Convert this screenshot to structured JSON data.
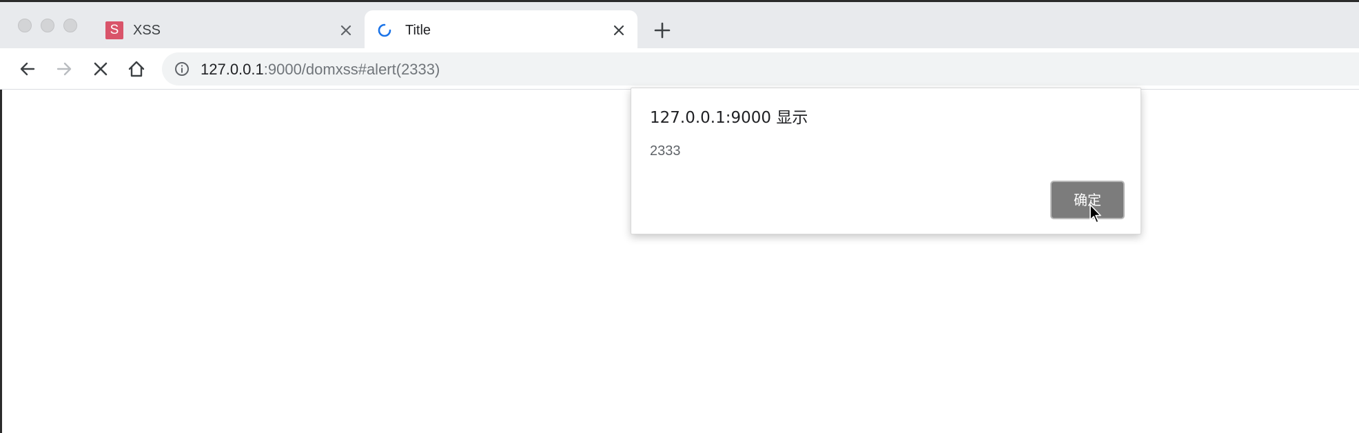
{
  "tabs": [
    {
      "favicon_letter": "S",
      "title": "XSS",
      "favicon_color": "#d9546a",
      "active": false
    },
    {
      "title": "Title",
      "active": true,
      "loading": true,
      "spinner_color": "#1a73e8"
    }
  ],
  "toolbar": {
    "back_icon": "arrow-left-icon",
    "forward_icon": "arrow-right-icon",
    "stop_icon": "close-icon",
    "home_icon": "home-icon"
  },
  "omnibox": {
    "info_icon": "info-icon",
    "url_host": "127.0.0.1",
    "url_rest": ":9000/domxss#alert(2333)"
  },
  "dialog": {
    "title": "127.0.0.1:9000 显示",
    "message": "2333",
    "ok_label": "确定"
  }
}
